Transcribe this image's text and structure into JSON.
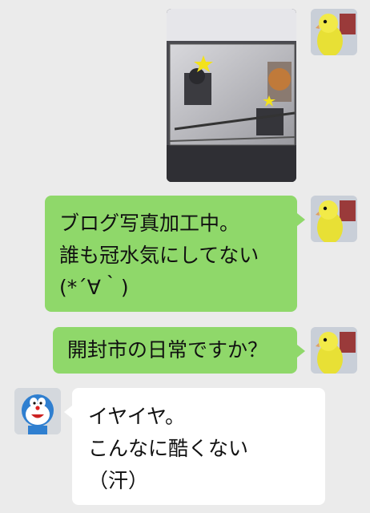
{
  "messages": [
    {
      "sender": "self",
      "type": "image",
      "image_desc": "photo-of-monitor-showing-photo-with-star-marks"
    },
    {
      "sender": "self",
      "type": "text",
      "lines": [
        "ブログ写真加工中。",
        "誰も冠水気にしてない",
        "(*´∀｀)"
      ]
    },
    {
      "sender": "self",
      "type": "text",
      "lines": [
        "開封市の日常ですか？"
      ]
    },
    {
      "sender": "other",
      "type": "text",
      "lines": [
        "イヤイヤ。",
        "こんなに酷くない",
        "（汗）"
      ]
    }
  ],
  "colors": {
    "background": "#ebebeb",
    "self_bubble": "#8fd86a",
    "other_bubble": "#ffffff"
  },
  "avatars": {
    "self": "yellow-parakeet-avatar",
    "other": "doraemon-figure-avatar"
  }
}
